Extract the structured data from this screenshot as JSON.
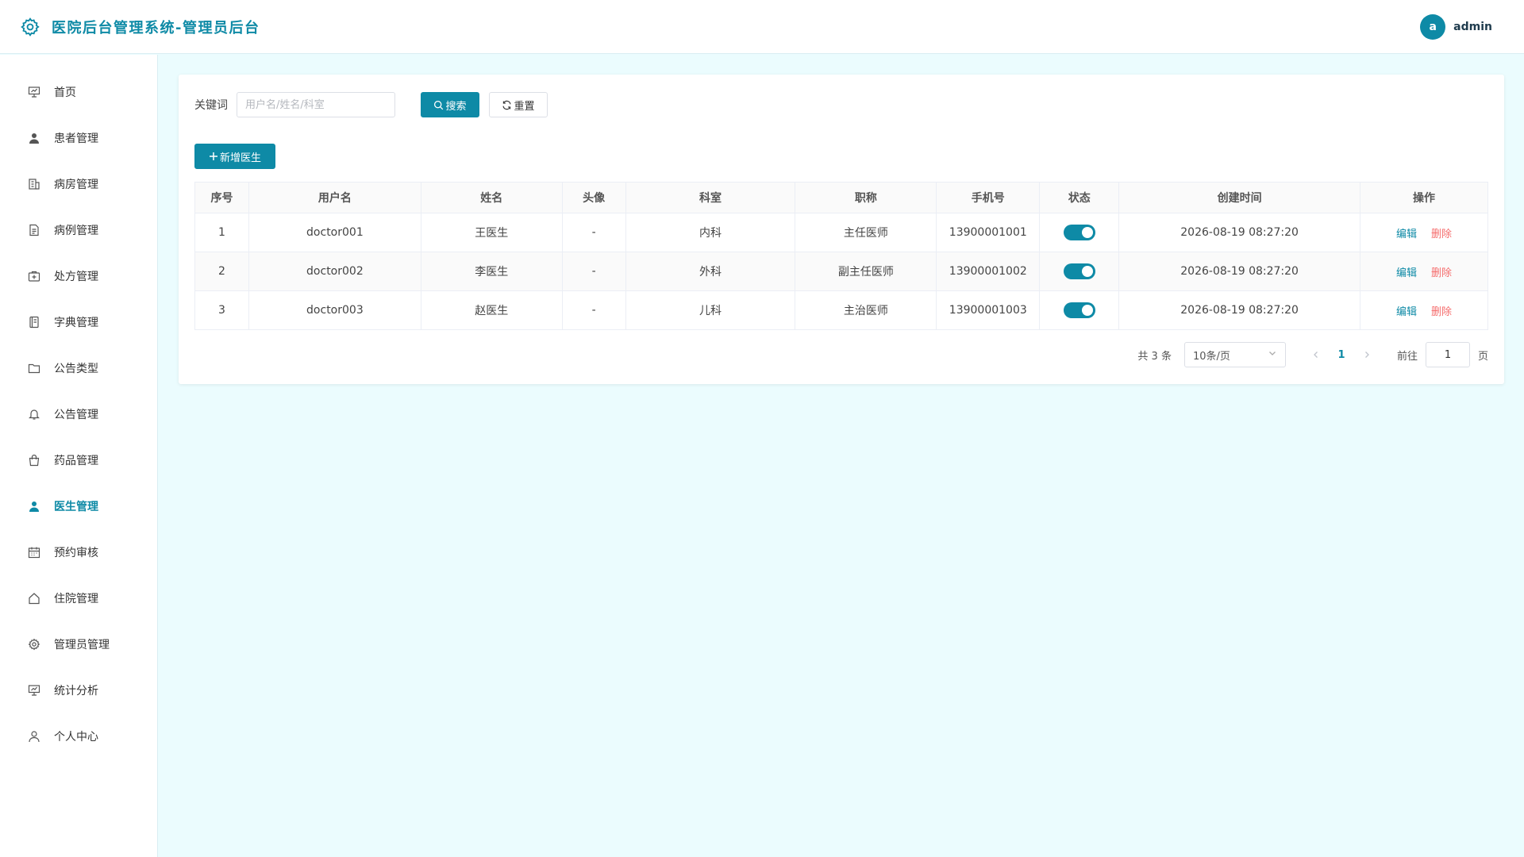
{
  "header": {
    "title": "医院后台管理系统-管理员后台",
    "user": {
      "avatar_letter": "a",
      "name": "admin"
    }
  },
  "colors": {
    "primary": "#0e8aa6",
    "danger": "#f56c6c",
    "background": "#ebfcfe"
  },
  "sidebar": {
    "items": [
      {
        "label": "首页",
        "icon": "presentation-icon"
      },
      {
        "label": "患者管理",
        "icon": "user-filled-icon"
      },
      {
        "label": "病房管理",
        "icon": "building-icon"
      },
      {
        "label": "病例管理",
        "icon": "document-icon"
      },
      {
        "label": "处方管理",
        "icon": "first-aid-kit-icon"
      },
      {
        "label": "字典管理",
        "icon": "notebook-icon"
      },
      {
        "label": "公告类型",
        "icon": "folder-icon"
      },
      {
        "label": "公告管理",
        "icon": "bell-icon"
      },
      {
        "label": "药品管理",
        "icon": "shopping-bag-icon"
      },
      {
        "label": "医生管理",
        "icon": "user-filled-icon",
        "active": true
      },
      {
        "label": "预约审核",
        "icon": "calendar-icon"
      },
      {
        "label": "住院管理",
        "icon": "house-icon"
      },
      {
        "label": "管理员管理",
        "icon": "gear-icon"
      },
      {
        "label": "统计分析",
        "icon": "presentation-icon"
      },
      {
        "label": "个人中心",
        "icon": "user-outline-icon"
      }
    ]
  },
  "search": {
    "label": "关键词",
    "placeholder": "用户名/姓名/科室",
    "value": "",
    "search_label": "搜索",
    "reset_label": "重置"
  },
  "toolbar": {
    "add_label": "新增医生"
  },
  "table": {
    "columns": [
      "序号",
      "用户名",
      "姓名",
      "头像",
      "科室",
      "职称",
      "手机号",
      "状态",
      "创建时间",
      "操作"
    ],
    "rows": [
      {
        "index": "1",
        "username": "doctor001",
        "name": "王医生",
        "avatar": "-",
        "department": "内科",
        "title": "主任医师",
        "phone": "13900001001",
        "enabled": true,
        "created": "2026-08-19 08:27:20"
      },
      {
        "index": "2",
        "username": "doctor002",
        "name": "李医生",
        "avatar": "-",
        "department": "外科",
        "title": "副主任医师",
        "phone": "13900001002",
        "enabled": true,
        "created": "2026-08-19 08:27:20"
      },
      {
        "index": "3",
        "username": "doctor003",
        "name": "赵医生",
        "avatar": "-",
        "department": "儿科",
        "title": "主治医师",
        "phone": "13900001003",
        "enabled": true,
        "created": "2026-08-19 08:27:20"
      }
    ],
    "edit_label": "编辑",
    "delete_label": "删除"
  },
  "pagination": {
    "total_text": "共 3 条",
    "page_size_text": "10条/页",
    "current_page": "1",
    "goto_label": "前往",
    "goto_value": "1",
    "page_unit": "页"
  }
}
